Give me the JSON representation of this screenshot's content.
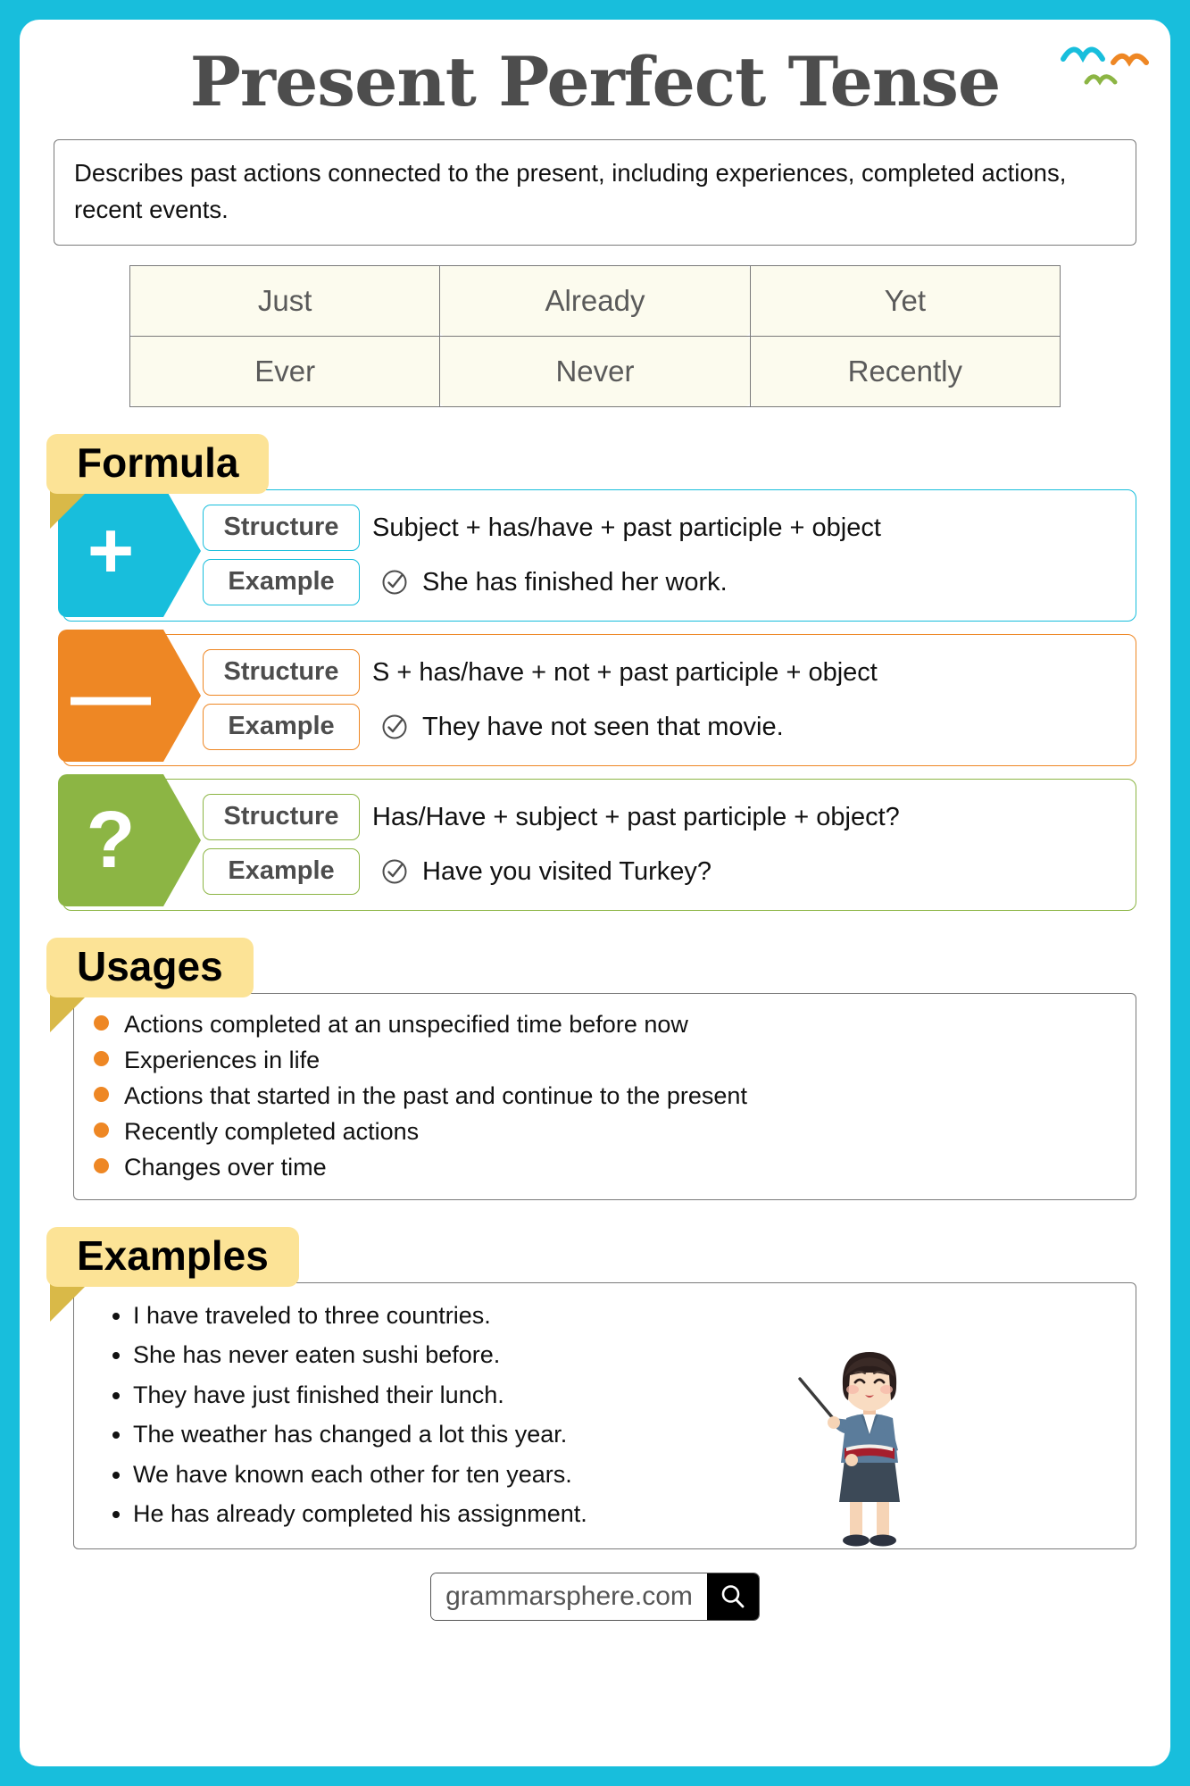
{
  "title": "Present Perfect Tense",
  "definition": "Describes past actions connected to the present, including experiences, completed actions, recent events.",
  "keywords": {
    "row1": [
      "Just",
      "Already",
      "Yet"
    ],
    "row2": [
      "Ever",
      "Never",
      "Recently"
    ]
  },
  "sections": {
    "formula_label": "Formula",
    "usages_label": "Usages",
    "examples_label": "Examples"
  },
  "formula": {
    "structure_label": "Structure",
    "example_label": "Example",
    "rows": [
      {
        "sign": "+",
        "sign_name": "plus-sign",
        "color": "#18BEDC",
        "structure": "Subject + has/have + past participle + object",
        "example": "She has finished her work."
      },
      {
        "sign": "—",
        "sign_name": "minus-sign",
        "color": "#EE8724",
        "structure": "S + has/have + not + past participle + object",
        "example": "They have not seen that movie."
      },
      {
        "sign": "?",
        "sign_name": "question-sign",
        "color": "#8CB544",
        "structure": "Has/Have + subject + past participle + object?",
        "example": "Have you visited Turkey?"
      }
    ]
  },
  "usages": [
    "Actions completed at an unspecified time before now",
    "Experiences in life",
    "Actions that started in the past and continue to the present",
    "Recently completed actions",
    "Changes over time"
  ],
  "examples": [
    "I have traveled to three countries.",
    "She has never eaten sushi before.",
    "They have just finished their lunch.",
    "The weather has changed a lot this year.",
    "We have known each other for ten years.",
    "He has already completed his assignment."
  ],
  "footer": {
    "url": "grammarsphere.com"
  },
  "colors": {
    "background": "#18BEDC",
    "tab": "#FCE396",
    "tab_fold": "#D9B948",
    "cell": "#FCFBEE",
    "positive": "#18BEDC",
    "negative": "#EE8724",
    "question": "#8CB544",
    "bullet": "#EE8724"
  }
}
